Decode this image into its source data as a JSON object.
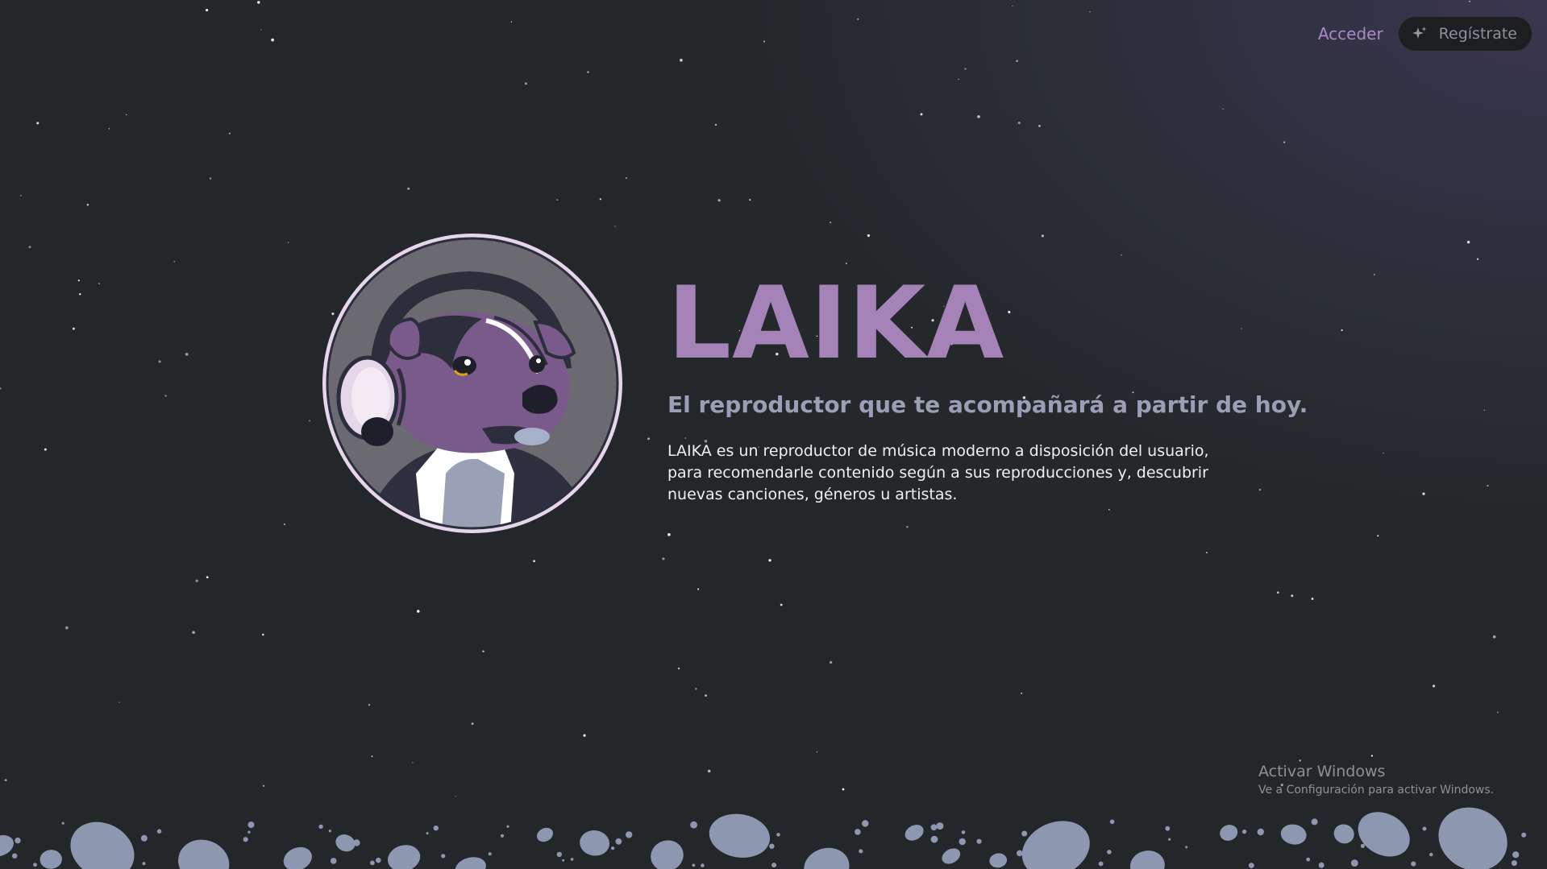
{
  "nav": {
    "login_label": "Acceder",
    "register_label": "Regístrate",
    "register_icon": "sparkle-icon"
  },
  "hero": {
    "logo_icon": "laika-dog-headphones-logo",
    "title": "LAIKA",
    "subtitle": "El reproductor que te acompañará a partir de hoy.",
    "description": "LAIKA es un reproductor de música moderno a disposición del usuario, para recomendarle contenido según a sus reproducciones y, descubrir nuevas canciones, géneros u artistas."
  },
  "os_watermark": {
    "title": "Activar Windows",
    "subtitle": "Ve a Configuración para activar Windows."
  },
  "colors": {
    "accent": "#a583b8",
    "subtitle": "#9a9fb5",
    "rocks": "#8e97b0",
    "ring": "#e6d6ea"
  }
}
